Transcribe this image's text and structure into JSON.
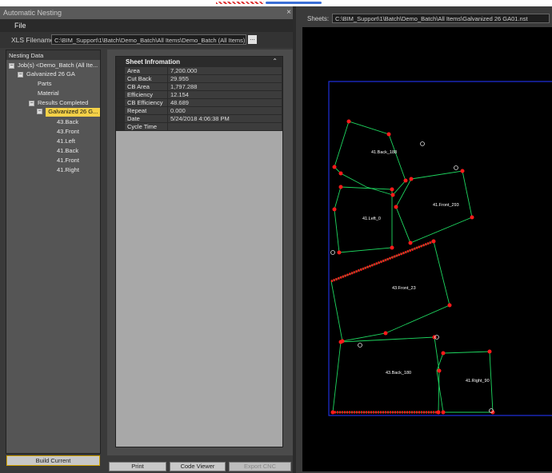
{
  "window": {
    "title": "Automatic Nesting",
    "close": "×"
  },
  "menu": {
    "file": "File"
  },
  "xls": {
    "label": "XLS Filename:",
    "value": "C:\\BIM_Support\\1\\Batch\\Demo_Batch\\All Items\\Demo_Batch (All Items).xls",
    "browse": "..."
  },
  "tree": {
    "header": "Nesting Data",
    "nodes": [
      "Job(s) <Demo_Batch (All Ite...",
      "Galvanized 26 GA",
      "Parts",
      "Material",
      "Results Completed",
      "Galvanized 26 G...",
      "43.Back",
      "43.Front",
      "41.Left",
      "41.Back",
      "41.Front",
      "41.Right"
    ]
  },
  "sheet_info": {
    "title": "Sheet Infromation",
    "rows": [
      {
        "key": "Area",
        "value": "7,200.000"
      },
      {
        "key": "Cut Back",
        "value": "29.955"
      },
      {
        "key": "CB Area",
        "value": "1,797.288"
      },
      {
        "key": "Efficiency",
        "value": "12.154"
      },
      {
        "key": "CB Efficiency",
        "value": "48.689"
      },
      {
        "key": "Repeat",
        "value": "0.000"
      },
      {
        "key": "Date",
        "value": "5/24/2018 4:06:38 PM"
      },
      {
        "key": "Cycle Time",
        "value": ""
      }
    ]
  },
  "buttons": {
    "build_current": "Build Current",
    "print": "Print",
    "code_viewer": "Code Viewer",
    "export_cnc": "Export CNC"
  },
  "sheets": {
    "label": "Sheets:",
    "value": "C:\\BIM_Support\\1\\Batch\\Demo_Batch\\All Items\\Galvanized 26 GA01.nst"
  },
  "parts": {
    "back_188": "41.Back_188",
    "front_293": "41.Front_293",
    "left_0": "41.Left_0",
    "front_23": "43.Front_23",
    "back_180": "43.Back_180",
    "right_90": "41.Right_90"
  },
  "colors": {
    "outline": "#1ed760",
    "points": "#ff1a1a",
    "sheet_border": "#1f2fd8",
    "selected": "#f4d148"
  }
}
